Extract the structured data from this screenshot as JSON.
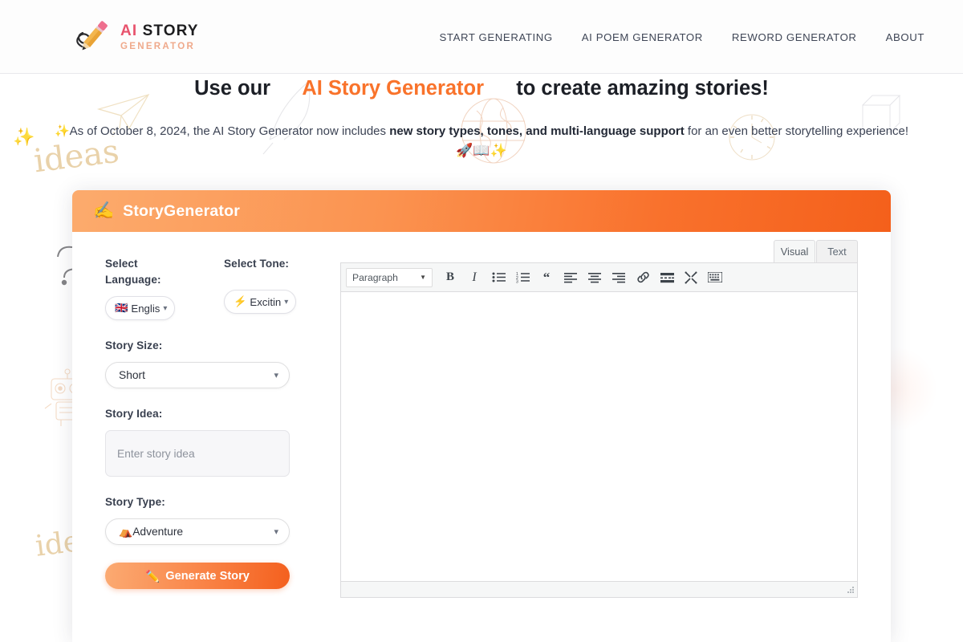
{
  "header": {
    "brand": {
      "line1_ai": "AI",
      "line1_story": "STORY",
      "line2": "GENERATOR",
      "logo_icon": "pencil-logo"
    },
    "nav": [
      {
        "label": "START GENERATING"
      },
      {
        "label": "AI POEM GENERATOR"
      },
      {
        "label": "REWORD GENERATOR"
      },
      {
        "label": "ABOUT"
      }
    ]
  },
  "hero": {
    "title_prefix": "Use our",
    "title_accent": "AI Story Generator",
    "title_suffix": "to create amazing stories!",
    "sub_sparkle": "✨",
    "sub_before": "As of October 8, 2024, the AI Story Generator now includes",
    "sub_bold": "new story types, tones, and multi-language support",
    "sub_after": "for an even better storytelling experience!",
    "emoji_row": "🚀📖✨",
    "doodle_word_1": "ideas",
    "doodle_word_2": "ideas"
  },
  "generator": {
    "header_icon": "writing-hand-icon",
    "header_title": "StoryGenerator",
    "labels": {
      "language": "Select Language:",
      "tone": "Select Tone:",
      "size": "Story Size:",
      "idea": "Story Idea:",
      "type": "Story Type:"
    },
    "language": {
      "flag": "🇬🇧",
      "value": "Englis"
    },
    "tone": {
      "icon": "⚡",
      "value": "Excitin"
    },
    "size": {
      "value": "Short"
    },
    "idea": {
      "value": "",
      "placeholder": "Enter story idea"
    },
    "type": {
      "icon": "⛺",
      "value": "Adventure"
    },
    "generate_button": {
      "icon": "✏️",
      "label": "Generate Story"
    }
  },
  "editor": {
    "tabs": [
      {
        "label": "Visual",
        "active": true
      },
      {
        "label": "Text",
        "active": false
      }
    ],
    "format_select": "Paragraph",
    "toolbar": [
      {
        "name": "bold-icon",
        "title": "Bold"
      },
      {
        "name": "italic-icon",
        "title": "Italic"
      },
      {
        "name": "bulleted-list-icon",
        "title": "Bulleted list"
      },
      {
        "name": "numbered-list-icon",
        "title": "Numbered list"
      },
      {
        "name": "blockquote-icon",
        "title": "Blockquote"
      },
      {
        "name": "align-left-icon",
        "title": "Align left"
      },
      {
        "name": "align-center-icon",
        "title": "Align center"
      },
      {
        "name": "align-right-icon",
        "title": "Align right"
      },
      {
        "name": "insert-link-icon",
        "title": "Insert link"
      },
      {
        "name": "read-more-icon",
        "title": "Insert Read More tag"
      },
      {
        "name": "fullscreen-icon",
        "title": "Distraction-free writing mode"
      },
      {
        "name": "toolbar-toggle-icon",
        "title": "Toolbar Toggle"
      }
    ],
    "content": ""
  },
  "colors": {
    "accent_orange": "#f9732b",
    "brand_pink": "#e8536d",
    "brand_peach": "#efa98b",
    "nav_text": "#3f4656",
    "doodle_gold": "#e2c38e",
    "editor_chrome": "#f6f7f7"
  }
}
